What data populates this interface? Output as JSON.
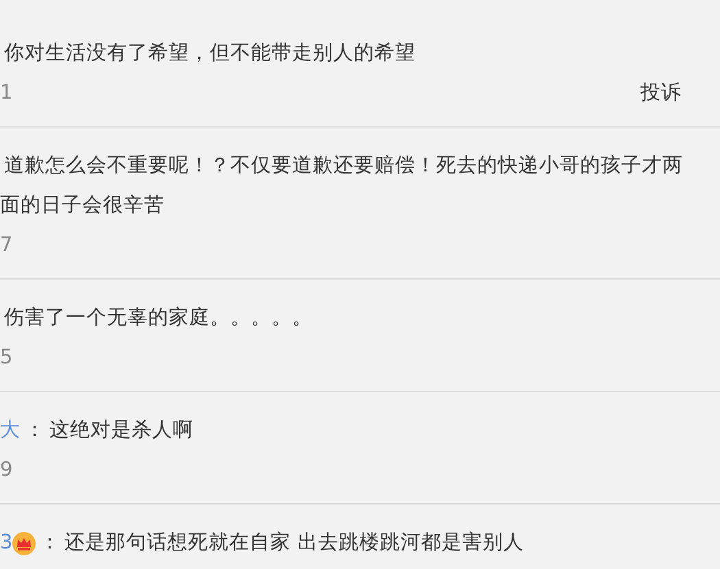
{
  "comments": [
    {
      "lines": [
        "你对生活没有了希望，但不能带走别人的希望"
      ],
      "count": "1",
      "actions": [
        "投诉"
      ]
    },
    {
      "lines": [
        "道歉怎么会不重要呢！？不仅要道歉还要赔偿！死去的快递小哥的孩子才两",
        "面的日子会很辛苦"
      ],
      "count": "7"
    },
    {
      "lines": [
        "伤害了一个无辜的家庭。。。。。"
      ],
      "count": "5"
    },
    {
      "user": "大",
      "sep": "：",
      "lines": [
        "这绝对是杀人啊"
      ],
      "count": "9"
    },
    {
      "user": "3",
      "badge": true,
      "sep": "：",
      "lines": [
        "还是那句话想死就在自家 出去跳楼跳河都是害别人"
      ]
    }
  ]
}
